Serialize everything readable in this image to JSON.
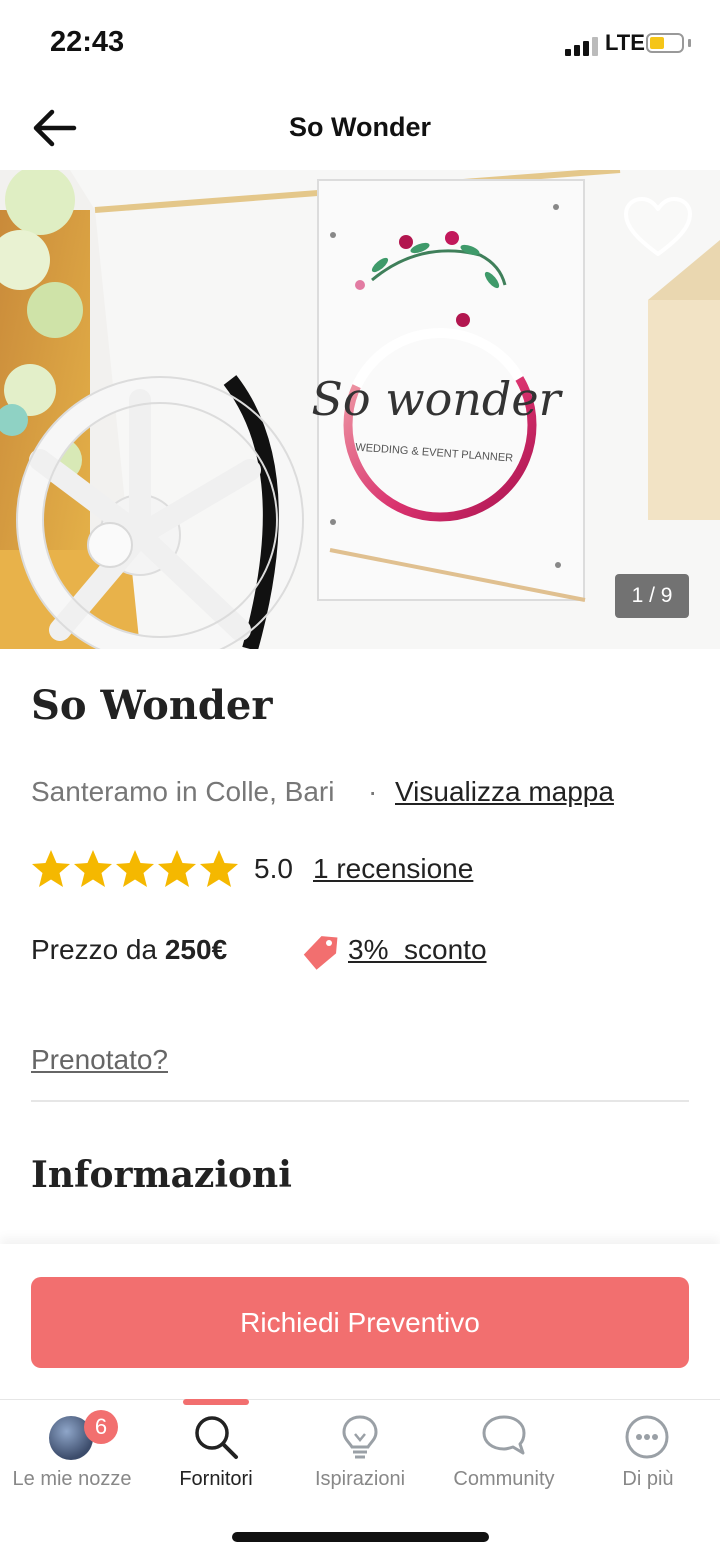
{
  "status_bar": {
    "time": "22:43",
    "network": "LTE"
  },
  "header": {
    "title": "So Wonder",
    "back_icon": "arrow-left-icon"
  },
  "hero": {
    "logo_script": "So wonder",
    "logo_tagline": "WEDDING & EVENT PLANNER",
    "photo_counter": "1 / 9",
    "favorite_icon": "heart-icon"
  },
  "vendor": {
    "name": "So Wonder",
    "location": "Santeramo in Colle, Bari",
    "separator": "·",
    "map_link": "Visualizza mappa",
    "rating": "5.0",
    "rating_value": 5,
    "rating_max": 5,
    "reviews_link": "1 recensione",
    "price_label": "Prezzo da ",
    "price_value": "250€",
    "discount": "3%  sconto",
    "booked_link": "Prenotato?",
    "section_title": "Informazioni"
  },
  "cta": {
    "label": "Richiedi Preventivo"
  },
  "tabs": [
    {
      "label": "Le mie nozze",
      "icon": "avatar",
      "badge": "6"
    },
    {
      "label": "Fornitori",
      "icon": "search-icon",
      "active": true
    },
    {
      "label": "Ispirazioni",
      "icon": "lightbulb-icon"
    },
    {
      "label": "Community",
      "icon": "chat-bubble-icon"
    },
    {
      "label": "Di più",
      "icon": "more-icon"
    }
  ],
  "colors": {
    "accent": "#f26f6f",
    "star": "#f5b800",
    "logo_ring": "#c2185b"
  }
}
